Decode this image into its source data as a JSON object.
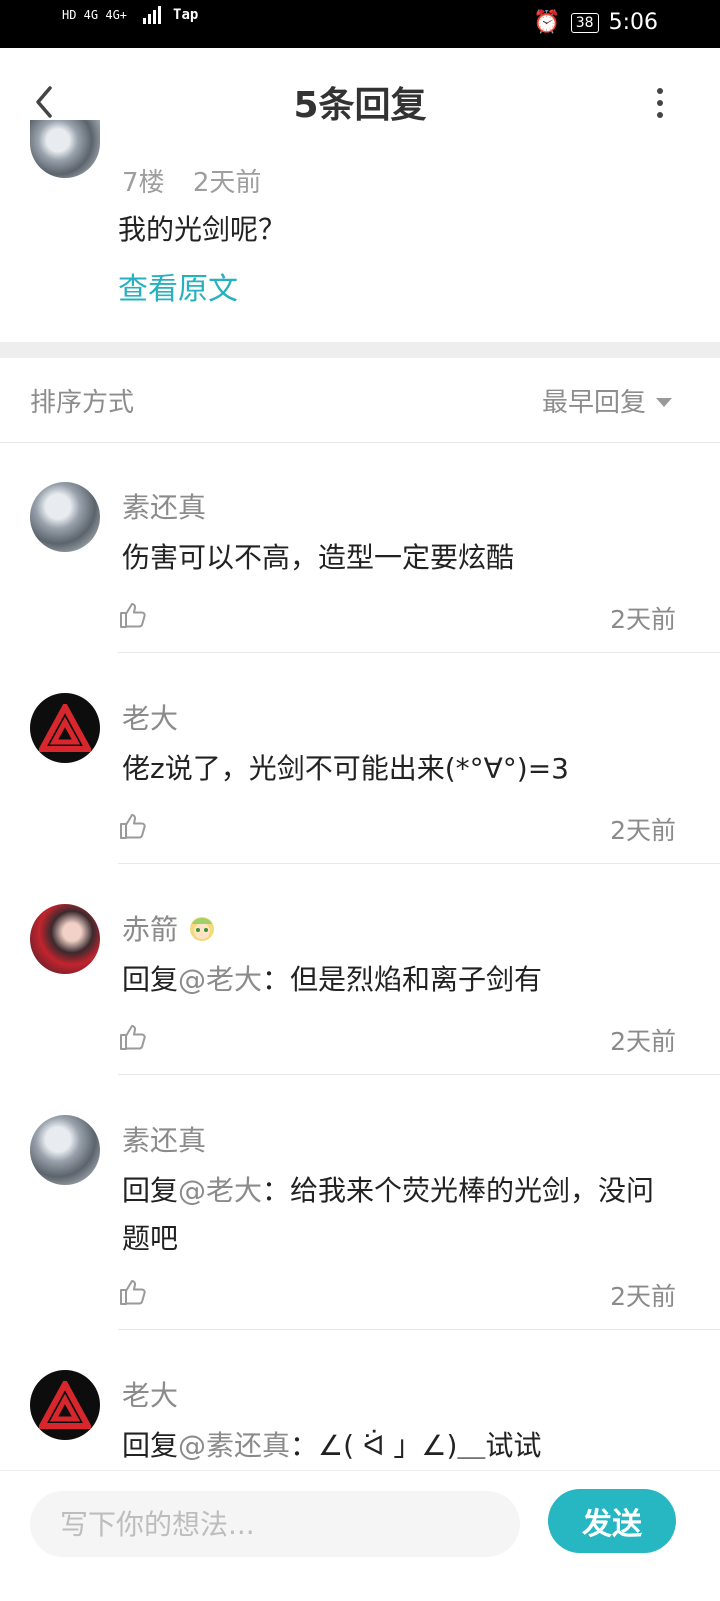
{
  "status_bar": {
    "network_left": "HD 4G 4G+",
    "tap_label": "Tap",
    "battery": "38",
    "time": "5:06"
  },
  "header": {
    "title": "5条回复"
  },
  "original_post": {
    "floor": "7楼",
    "time": "2天前",
    "text": "我的光剑呢？",
    "view_original": "查看原文"
  },
  "sort": {
    "label": "排序方式",
    "value": "最早回复"
  },
  "replies": [
    {
      "name": "素还真",
      "text": "伤害可以不高，造型一定要炫酷",
      "time": "2天前"
    },
    {
      "name": "老大",
      "text": "佬z说了，光剑不可能出来(*°∀°)=3",
      "time": "2天前"
    },
    {
      "name": "赤箭",
      "mention_prefix": "回复",
      "mention": "@老大",
      "text": "：但是烈焰和离子剑有",
      "time": "2天前"
    },
    {
      "name": "素还真",
      "mention_prefix": "回复",
      "mention": "@老大",
      "text": "：给我来个荧光棒的光剑，没问题吧",
      "time": "2天前"
    },
    {
      "name": "老大",
      "mention_prefix": "回复",
      "mention": "@素还真",
      "text": "：∠( ᐛ 」∠)＿试试"
    }
  ],
  "composer": {
    "placeholder": "写下你的想法...",
    "send_label": "发送"
  },
  "colors": {
    "accent": "#26b7c3",
    "link": "#26b1c0",
    "logo_red": "#d8262d"
  }
}
